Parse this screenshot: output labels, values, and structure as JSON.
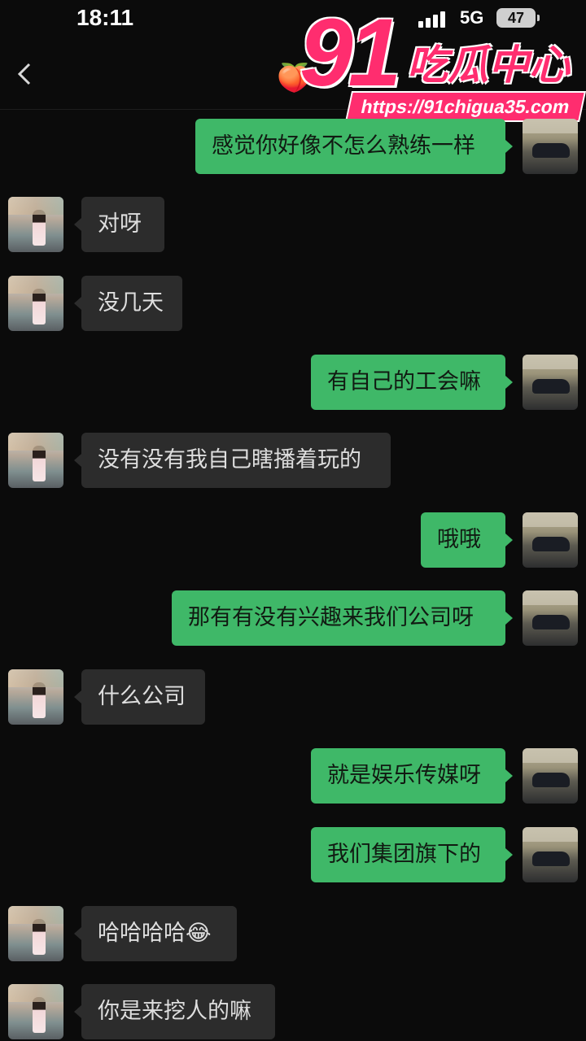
{
  "status": {
    "time": "18:11",
    "network": "5G",
    "battery": "47"
  },
  "header": {
    "back_icon": "chevron-left-icon",
    "contact_emoji": "🍑"
  },
  "watermark": {
    "number": "91",
    "text": "吃瓜中心",
    "url": "https://91chigua35.com"
  },
  "colors": {
    "outgoing": "#3fb868",
    "incoming": "#2c2c2c",
    "background": "#0b0b0b",
    "watermark": "#ff2d6f"
  },
  "messages": [
    {
      "side": "out",
      "text": "感觉你好像不怎么熟练一样"
    },
    {
      "side": "in",
      "text": "对呀"
    },
    {
      "side": "in",
      "text": "没几天"
    },
    {
      "side": "out",
      "text": "有自己的工会嘛"
    },
    {
      "side": "in",
      "text": "没有没有我自己瞎播着玩的"
    },
    {
      "side": "out",
      "text": "哦哦"
    },
    {
      "side": "out",
      "text": "那有有没有兴趣来我们公司呀"
    },
    {
      "side": "in",
      "text": "什么公司"
    },
    {
      "side": "out",
      "text": "就是娱乐传媒呀"
    },
    {
      "side": "out",
      "text": "我们集团旗下的"
    },
    {
      "side": "in",
      "text": "哈哈哈哈😂"
    },
    {
      "side": "in",
      "text": "你是来挖人的嘛"
    }
  ]
}
